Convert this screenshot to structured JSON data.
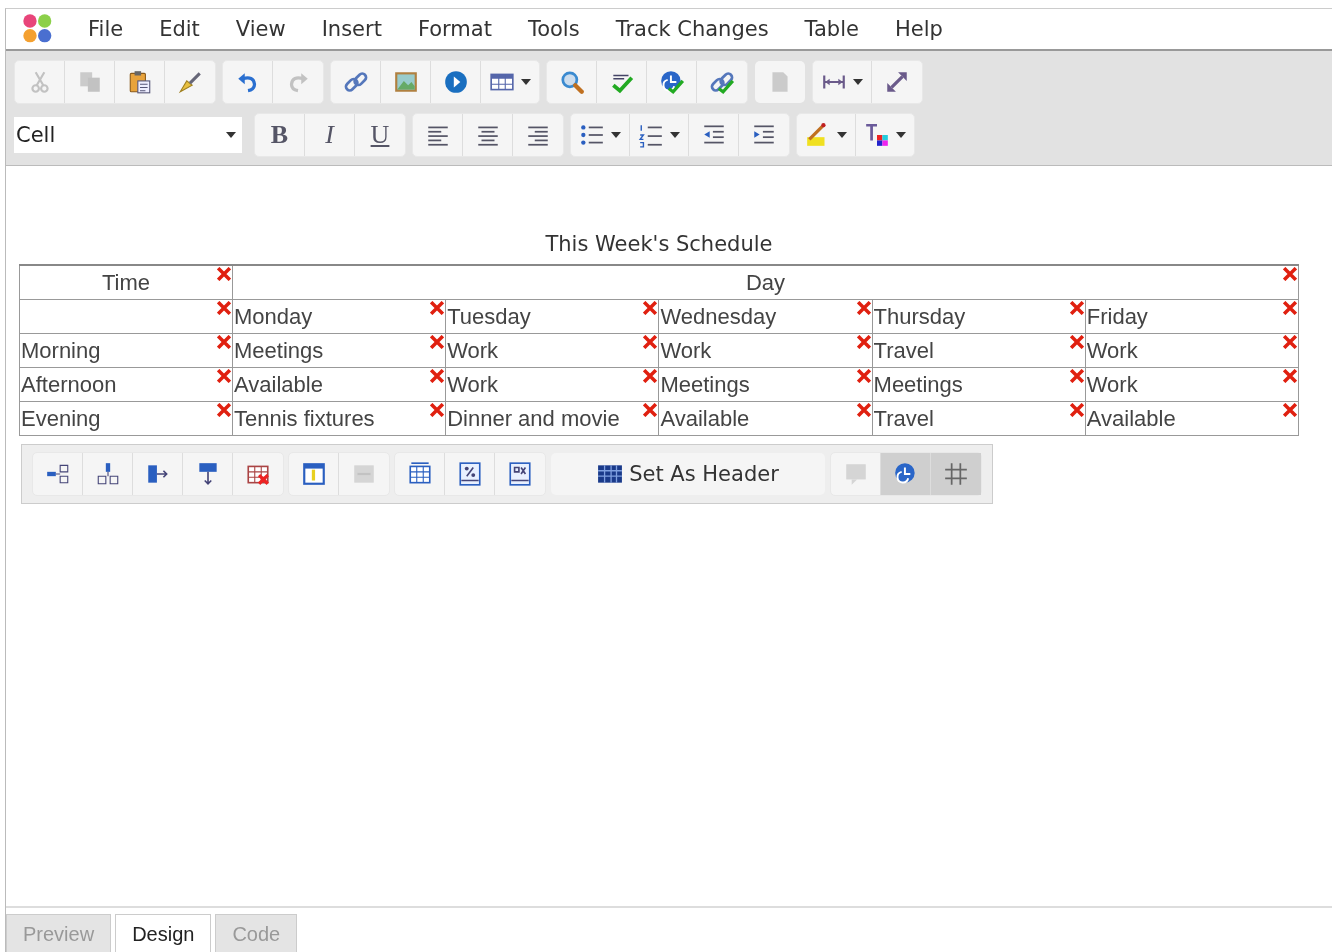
{
  "menu": [
    {
      "label": "File"
    },
    {
      "label": "Edit"
    },
    {
      "label": "View"
    },
    {
      "label": "Insert"
    },
    {
      "label": "Format"
    },
    {
      "label": "Tools"
    },
    {
      "label": "Track Changes"
    },
    {
      "label": "Table"
    },
    {
      "label": "Help"
    }
  ],
  "toolbar_1": {
    "groups": [
      [
        {
          "disabled": true,
          "dropdown": false
        },
        {
          "disabled": true,
          "dropdown": false
        },
        {
          "disabled": false,
          "dropdown": false
        },
        {
          "disabled": false,
          "dropdown": false
        }
      ],
      [
        {
          "disabled": false,
          "dropdown": false
        },
        {
          "disabled": true,
          "dropdown": false
        }
      ],
      [
        {
          "disabled": false,
          "dropdown": false
        },
        {
          "disabled": false,
          "dropdown": false
        },
        {
          "disabled": false,
          "dropdown": false
        },
        {
          "disabled": false,
          "dropdown": true
        }
      ],
      [
        {
          "disabled": false,
          "dropdown": false
        },
        {
          "disabled": false,
          "dropdown": false
        },
        {
          "disabled": false,
          "dropdown": false
        },
        {
          "disabled": false,
          "dropdown": false
        }
      ],
      [
        {
          "disabled": true,
          "dropdown": false
        }
      ],
      [
        {
          "disabled": false,
          "dropdown": true
        },
        {
          "disabled": false,
          "dropdown": false
        }
      ]
    ]
  },
  "toolbar_2": {
    "style_select": {
      "value": "Cell"
    },
    "groups": [
      [
        {
          "label": "B",
          "disabled": false,
          "dropdown": false
        },
        {
          "label": "I",
          "disabled": false,
          "dropdown": false
        },
        {
          "label": "U",
          "disabled": false,
          "dropdown": false
        }
      ],
      [
        {
          "disabled": false,
          "dropdown": false
        },
        {
          "disabled": false,
          "dropdown": false
        },
        {
          "disabled": false,
          "dropdown": false
        }
      ],
      [
        {
          "disabled": false,
          "dropdown": true
        },
        {
          "disabled": false,
          "dropdown": true
        },
        {
          "disabled": false,
          "dropdown": false
        },
        {
          "disabled": false,
          "dropdown": false
        }
      ],
      [
        {
          "disabled": false,
          "dropdown": true
        },
        {
          "disabled": false,
          "dropdown": true
        }
      ]
    ]
  },
  "document": {
    "caption": "This Week's Schedule",
    "rows": [
      {
        "kind": "header",
        "cells": [
          {
            "text": "Time"
          },
          {
            "text": "Day",
            "colspan": 5
          }
        ]
      },
      {
        "kind": "body",
        "cells": [
          {},
          {
            "text": "Monday"
          },
          {
            "text": "Tuesday"
          },
          {
            "text": "Wednesday"
          },
          {
            "text": "Thursday"
          },
          {
            "text": "Friday"
          }
        ]
      },
      {
        "kind": "body",
        "cells": [
          {
            "text": "Morning"
          },
          {
            "text": "Meetings"
          },
          {
            "text": "Work"
          },
          {
            "text": "Work"
          },
          {
            "text": "Travel"
          },
          {
            "text": "Work"
          }
        ]
      },
      {
        "kind": "body",
        "cells": [
          {
            "text": "Afternoon"
          },
          {
            "text": "Available"
          },
          {
            "text": "Work"
          },
          {
            "text": "Meetings"
          },
          {
            "text": "Meetings"
          },
          {
            "text": "Work"
          }
        ]
      },
      {
        "kind": "body",
        "cells": [
          {
            "text": "Evening"
          },
          {
            "text": "Tennis fixtures"
          },
          {
            "text": "Dinner and movie"
          },
          {
            "text": "Available"
          },
          {
            "text": "Travel"
          },
          {
            "text": "Available"
          }
        ]
      }
    ]
  },
  "table_toolbar": {
    "groups": [
      [
        {
          "disabled": false,
          "pressed": false
        },
        {
          "disabled": false,
          "pressed": false
        },
        {
          "disabled": false,
          "pressed": false
        },
        {
          "disabled": false,
          "pressed": false
        },
        {
          "disabled": false,
          "pressed": false
        }
      ],
      [
        {
          "disabled": false,
          "pressed": false
        },
        {
          "disabled": true,
          "pressed": false
        }
      ],
      [
        {
          "disabled": false,
          "pressed": false
        },
        {
          "disabled": false,
          "pressed": false
        },
        {
          "disabled": false,
          "pressed": false
        }
      ],
      [
        {
          "label": "Set As Header",
          "disabled": false,
          "pressed": false
        }
      ],
      [
        {
          "disabled": true,
          "pressed": false
        },
        {
          "disabled": false,
          "pressed": true
        },
        {
          "disabled": false,
          "pressed": true
        }
      ]
    ]
  },
  "view_tabs": [
    {
      "label": "Preview",
      "selected": false
    },
    {
      "label": "Design",
      "selected": true
    },
    {
      "label": "Code",
      "selected": false
    }
  ]
}
